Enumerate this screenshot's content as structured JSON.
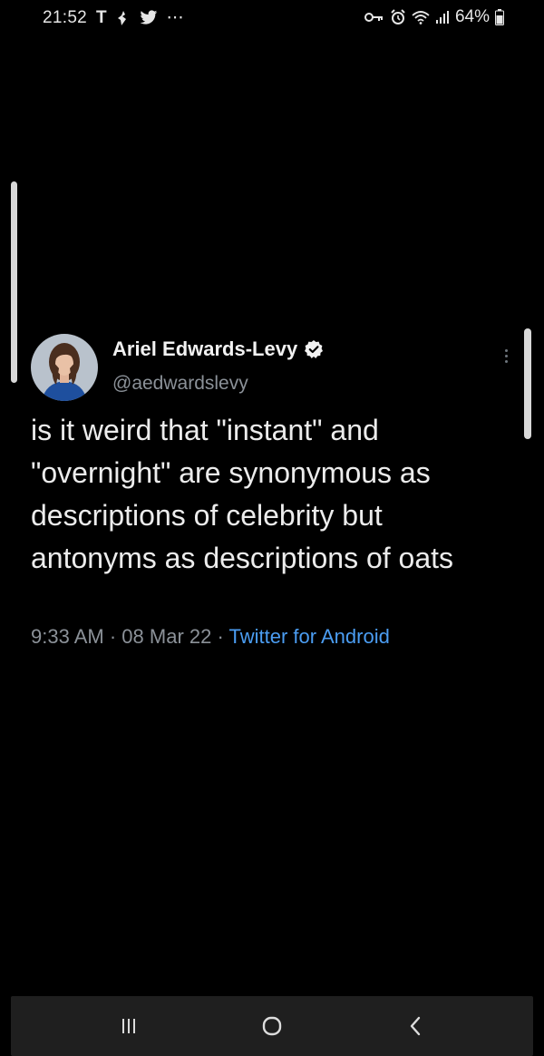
{
  "status_bar": {
    "time": "21:52",
    "left_icons": [
      "T",
      "notification-icon",
      "twitter-bird-icon",
      "more-dots-icon"
    ],
    "right_icons": [
      "vpn-key-icon",
      "alarm-icon",
      "wifi-icon",
      "signal-icon",
      "battery-icon"
    ],
    "battery_text": "64%",
    "carrier_glyph": "T",
    "more_glyph": "⋯"
  },
  "tweet": {
    "display_name": "Ariel Edwards-Levy",
    "verified": true,
    "handle": "@aedwardslevy",
    "text": "is it weird that \"instant\" and \"overnight\" are synonymous as descriptions of celebrity but antonyms as descriptions of oats",
    "time": "9:33 AM",
    "separator": "·",
    "date": "08 Mar 22",
    "source": "Twitter for Android"
  },
  "nav_bar": {
    "recents_icon": "recents-icon",
    "home_icon": "home-icon",
    "back_icon": "back-icon"
  },
  "colors": {
    "background": "#000000",
    "text": "#ececec",
    "muted": "#8b9198",
    "link": "#4b9df2",
    "nav_bar": "#1f1f1f"
  }
}
